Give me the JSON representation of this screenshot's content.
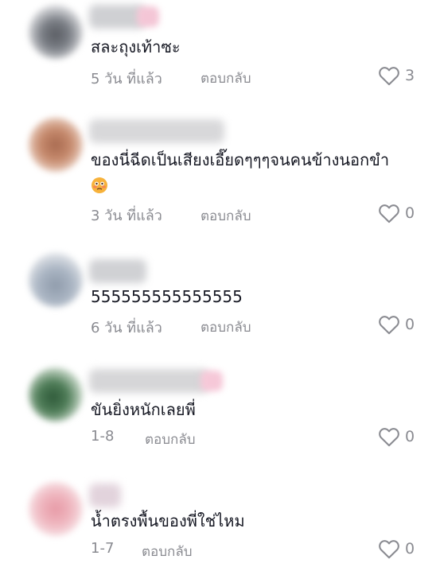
{
  "comments": [
    {
      "text": "สละถุงเท้าซะ",
      "time": "5 วัน ที่แล้ว",
      "reply_label": "ตอบกลับ",
      "likes": "3"
    },
    {
      "text": "ของนี่ฉีดเป็นเสียงเอี๊ยดๆๆๆจนคนข้างนอกขำ",
      "time": "3 วัน ที่แล้ว",
      "reply_label": "ตอบกลับ",
      "likes": "0"
    },
    {
      "text": "555555555555555",
      "time": "6 วัน ที่แล้ว",
      "reply_label": "ตอบกลับ",
      "likes": "0"
    },
    {
      "text": "ขันยิ่งหนักเลยพี่",
      "time": "1-8",
      "reply_label": "ตอบกลับ",
      "likes": "0"
    },
    {
      "text": "น้ำตรงพื้นของพี่ใช่ไหม",
      "time": "1-7",
      "reply_label": "ตอบกลับ",
      "likes": "0"
    }
  ],
  "icons": {
    "like": "heart-outline-icon",
    "emoji": "flushed-face-emoji"
  },
  "colors": {
    "text": "#161823",
    "meta": "#8a8b91"
  }
}
